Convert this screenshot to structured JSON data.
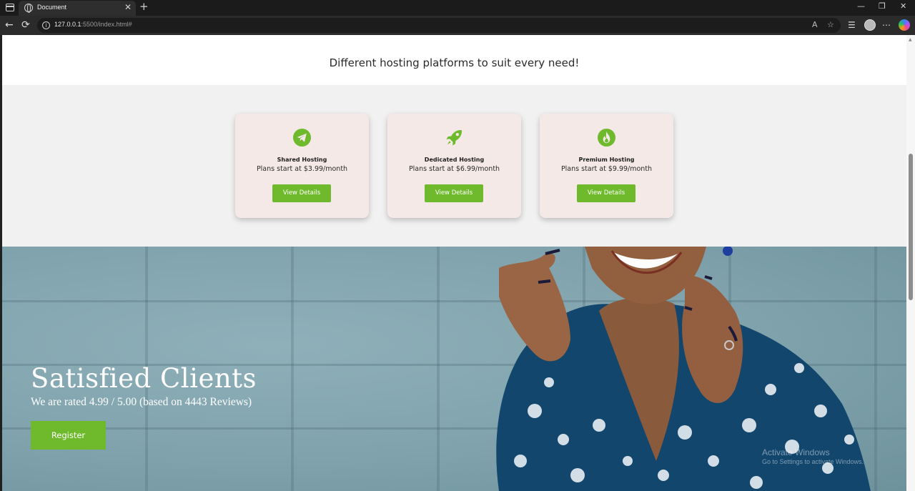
{
  "browser": {
    "tab_title": "Document",
    "tab_close": "✕",
    "new_tab": "+",
    "url_host": "127.0.0.1",
    "url_rest": ":5500/index.html#",
    "window_controls": {
      "minimize": "—",
      "restore": "❐",
      "close": "✕"
    },
    "nav": {
      "back": "←",
      "reload": "⟳"
    }
  },
  "intro": {
    "heading": "Different hosting platforms to suit every need!"
  },
  "plans": [
    {
      "icon": "paper-plane-icon",
      "title": "Shared Hosting",
      "desc": "Plans start at $3.99/month",
      "button": "View Details"
    },
    {
      "icon": "rocket-icon",
      "title": "Dedicated Hosting",
      "desc": "Plans start at $6.99/month",
      "button": "View Details"
    },
    {
      "icon": "fire-icon",
      "title": "Premium Hosting",
      "desc": "Plans start at $9.99/month",
      "button": "View Details"
    }
  ],
  "hero": {
    "title": "Satisfied Clients",
    "subtitle": "We are rated 4.99 / 5.00 (based on 4443 Reviews)",
    "button": "Register"
  },
  "watermark": {
    "line1": "Activate Windows",
    "line2": "Go to Settings to activate Windows."
  },
  "colors": {
    "accent": "#6fba2c",
    "card_bg": "#f4e9e7",
    "section_bg": "#f1f1f1"
  }
}
